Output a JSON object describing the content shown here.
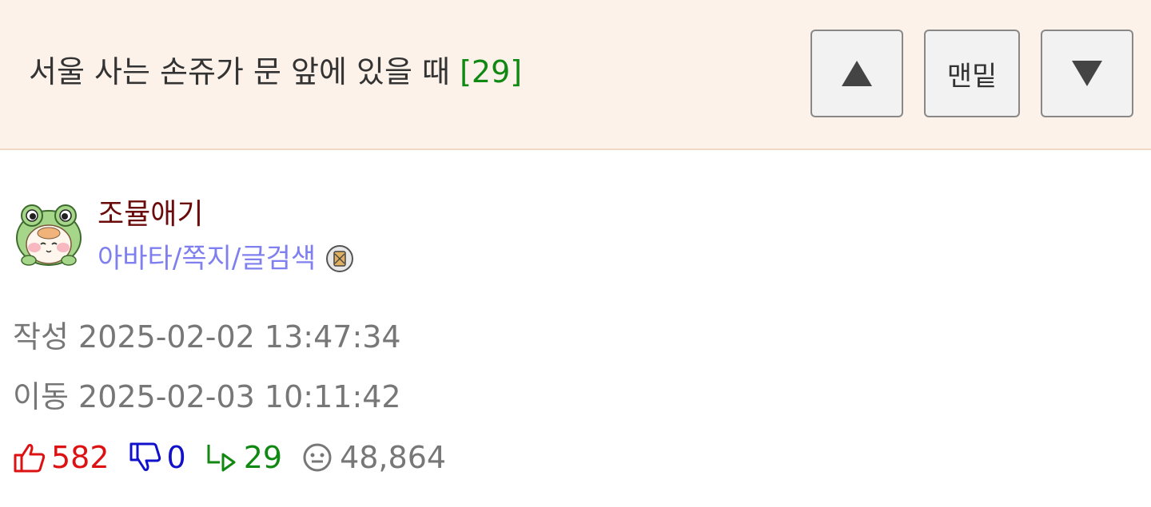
{
  "header": {
    "title": "서울 사는 손쥬가 문 앞에 있을 때",
    "comment_count": "[29]",
    "buttons": {
      "up_icon": "triangle-up-icon",
      "bottom_label": "맨밑",
      "down_icon": "triangle-down-icon"
    }
  },
  "author": {
    "avatar_icon": "frog-avatar",
    "nickname": "조뮬애기",
    "links": [
      "아바타",
      "쪽지",
      "글검색"
    ],
    "separator": "/",
    "badge_icon": "level-badge-icon"
  },
  "meta": {
    "written_label": "작성",
    "written": "2025-02-02 13:47:34",
    "moved_label": "이동",
    "moved": "2025-02-03 10:11:42"
  },
  "stats": {
    "likes": "582",
    "dislikes": "0",
    "replies": "29",
    "views": "48,864"
  },
  "colors": {
    "header_bg": "#fcf2ea",
    "comment_count": "#118811",
    "nickname": "#6b0a0a",
    "links": "#7f7ff0",
    "likes": "#dd1111",
    "dislikes": "#1111cc",
    "replies": "#118811"
  }
}
